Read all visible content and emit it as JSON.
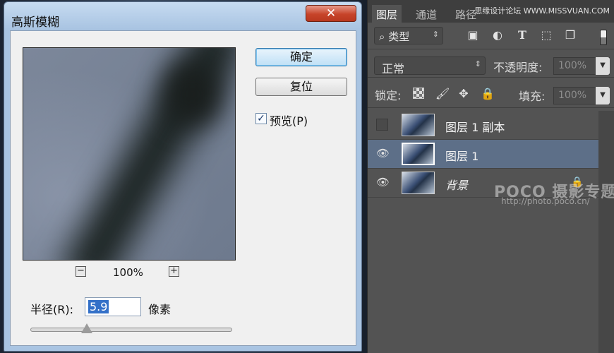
{
  "dialog": {
    "title": "高斯模糊",
    "close_symbol": "✕",
    "ok_label": "确定",
    "reset_label": "复位",
    "preview_label": "预览(P)",
    "preview_checked": true,
    "zoom_out_symbol": "−",
    "zoom_in_symbol": "+",
    "zoom_level": "100%",
    "radius_label": "半径(R):",
    "radius_value": "5.9",
    "radius_unit": "像素",
    "radius_slider_fraction": 0.28
  },
  "panel": {
    "tabs": [
      {
        "label": "图层",
        "active": true
      },
      {
        "label": "通道",
        "active": false
      },
      {
        "label": "路径",
        "active": false
      }
    ],
    "watermark_top": "思缘设计论坛 WWW.MISSVUAN.COM",
    "filter": {
      "label": "类型",
      "search_symbol": "⌕"
    },
    "filter_icons": [
      "image-icon",
      "adjustment-icon",
      "type-icon",
      "shape-icon",
      "smart-object-icon"
    ],
    "blend_mode": "正常",
    "opacity_label": "不透明度:",
    "opacity_value": "100%",
    "lock_label": "锁定:",
    "fill_label": "填充:",
    "fill_value": "100%",
    "layers": [
      {
        "name": "图层 1 副本",
        "visible": false,
        "selected": false,
        "locked": false
      },
      {
        "name": "图层 1",
        "visible": true,
        "selected": true,
        "locked": false
      },
      {
        "name": "背景",
        "visible": true,
        "selected": false,
        "locked": true
      }
    ],
    "watermark_logo": "POCO 摄影专题",
    "watermark_url": "http://photo.poco.cn/"
  },
  "colors": {
    "panel_bg": "#535353",
    "selected_layer": "#5d6f88",
    "ok_button_border": "#3c7fb1",
    "close_button": "#c7442a"
  }
}
